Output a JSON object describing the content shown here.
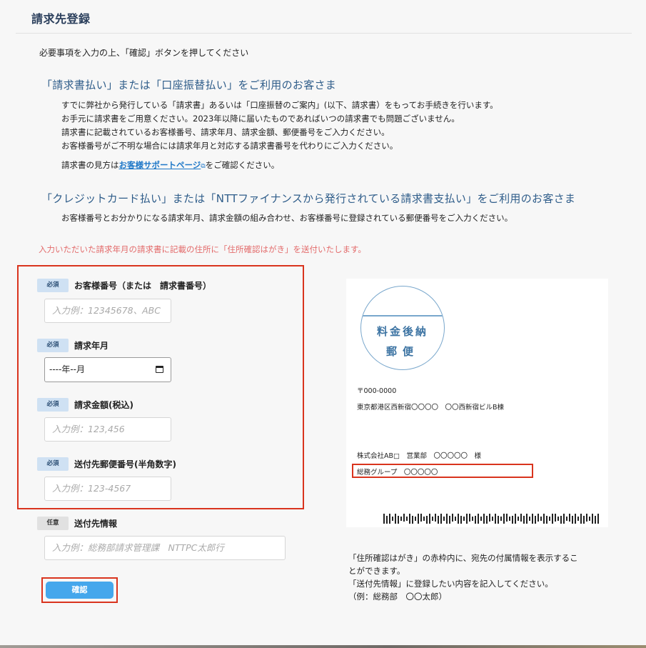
{
  "page": {
    "title": "請求先登録",
    "intro": "必要事項を入力の上、「確認」ボタンを押してください"
  },
  "section1": {
    "heading": "「請求書払い」または「口座振替払い」をご利用のお客さま",
    "lines": [
      "すでに弊社から発行している「請求書」あるいは「口座振替のご案内」(以下、請求書）をもってお手続きを行います。",
      "お手元に請求書をご用意ください。2023年以降に届いたものであればいつの請求書でも問題ございません。",
      "請求書に記載されているお客様番号、請求年月、請求金額、郵便番号をご入力ください。",
      "お客様番号がご不明な場合には請求年月と対応する請求書番号を代わりにご入力ください。"
    ],
    "help_prefix": "請求書の見方は",
    "help_link": "お客様サポートページ",
    "help_suffix": "をご確認ください。"
  },
  "section2": {
    "heading": "「クレジットカード払い」または「NTTファイナンスから発行されている請求書支払い」をご利用のお客さま",
    "text": "お客様番号とお分かりになる請求年月、請求金額の組み合わせ、お客様番号に登録されている郵便番号をご入力ください。"
  },
  "notice": "入力いただいた請求年月の請求書に記載の住所に「住所確認はがき」を送付いたします。",
  "badges": {
    "required": "必須",
    "optional": "任意"
  },
  "form": {
    "customer_number": {
      "label": "お客様番号（または　請求書番号）",
      "placeholder": "入力例：12345678、ABC"
    },
    "billing_month": {
      "label": "請求年月",
      "value": "----年--月"
    },
    "amount": {
      "label": "請求金額(税込)",
      "placeholder": "入力例：123,456"
    },
    "postal_code": {
      "label": "送付先郵便番号(半角数字)",
      "placeholder": "入力例：123-4567"
    },
    "recipient_info": {
      "label": "送付先情報",
      "placeholder": "入力例：総務部請求管理課　NTTPC太郎行"
    },
    "confirm_label": "確認"
  },
  "postcard": {
    "stamp_line1": "料金後納",
    "stamp_line2": "郵便",
    "zip": "〒000-0000",
    "address": "東京都港区西新宿〇〇〇〇　〇〇西新宿ビルB棟",
    "company": "株式会社AB□　営業部　〇〇〇〇〇　様",
    "group": "総務グループ　〇〇〇〇〇"
  },
  "caption": {
    "lines": [
      "「住所確認はがき」の赤枠内に、宛先の付属情報を表示するこ",
      "とができます。",
      "「送付先情報」に登録したい内容を記入してください。",
      "（例：総務部　〇〇太郎）"
    ]
  },
  "colors": {
    "heading_blue": "#2f5d8a",
    "accent_red": "#d9341e",
    "notice_red": "#e36b6b",
    "button_blue": "#45a7ec",
    "required_badge": "#cfe1f3",
    "stamp_blue": "#3d74a3"
  }
}
